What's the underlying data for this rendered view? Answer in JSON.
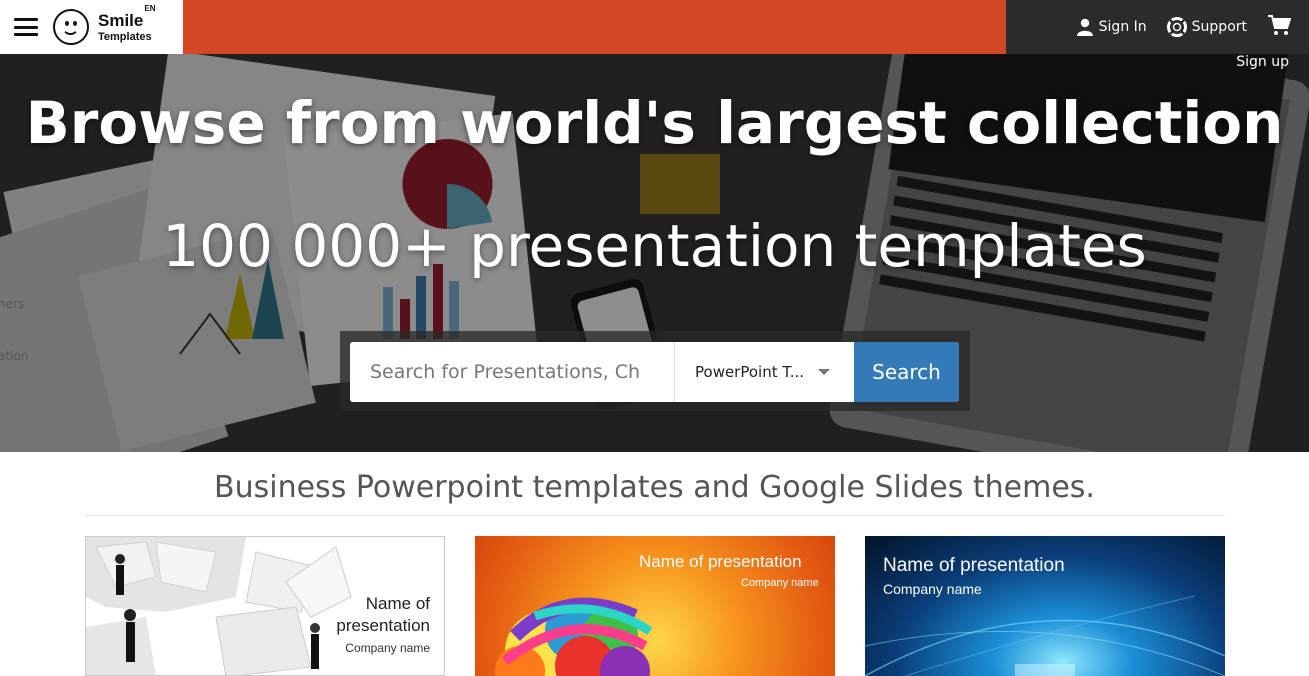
{
  "header": {
    "logo_brand": "Smile",
    "logo_lang": "EN",
    "logo_sub": "Templates",
    "sign_in": "Sign In",
    "support": "Support",
    "sign_up": "Sign up",
    "orange_color": "#d24726"
  },
  "hero": {
    "title": "Browse from world's largest collection",
    "subtitle": "100 000+ presentation templates",
    "side_texts": [
      "ners",
      "ation"
    ]
  },
  "search": {
    "placeholder": "Search for Presentations, Ch",
    "type_value": "PowerPoint T...",
    "button": "Search",
    "button_color": "#337ab7"
  },
  "section": {
    "title": "Business Powerpoint templates and Google Slides themes."
  },
  "cards": [
    {
      "name": "Name of presentation",
      "company": "Company name"
    },
    {
      "name": "Name of presentation",
      "company": "Company name"
    },
    {
      "name": "Name of presentation",
      "company": "Company name"
    }
  ]
}
